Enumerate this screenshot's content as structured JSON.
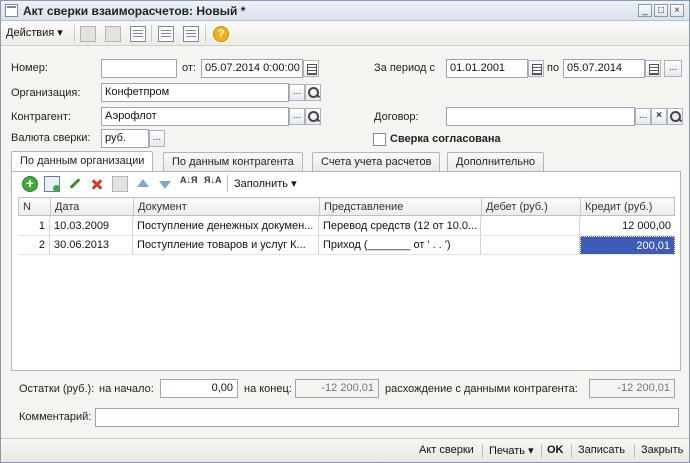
{
  "window": {
    "title": "Акт сверки взаиморасчетов: Новый *",
    "controls": {
      "minimize": "_",
      "maximize": "□",
      "close": "×"
    }
  },
  "toolbar": {
    "actions_label": "Действия",
    "icons": [
      "disabled-icon",
      "disabled-icon",
      "refresh-icon",
      "document-icon",
      "list-icon",
      "help-icon"
    ],
    "help_glyph": "?"
  },
  "header": {
    "number_label": "Номер:",
    "number_value": "",
    "from_label": "от:",
    "from_value": "05.07.2014  0:00:00",
    "period_label": "За период с",
    "period_start": "01.01.2001",
    "period_to_label": "по",
    "period_end": "05.07.2014",
    "org_label": "Организация:",
    "org_value": "Конфетпром",
    "contractor_label": "Контрагент:",
    "contractor_value": "Аэрофлот",
    "contract_label": "Договор:",
    "contract_value": "",
    "currency_label": "Валюта сверки:",
    "currency_value": "руб.",
    "agreed_label": "Сверка согласована",
    "ellipsis": "...",
    "clear_glyph": "×"
  },
  "tabs": [
    {
      "label": "По данным организации",
      "active": true
    },
    {
      "label": "По данным контрагента",
      "active": false
    },
    {
      "label": "Счета учета расчетов",
      "active": false
    },
    {
      "label": "Дополнительно",
      "active": false
    }
  ],
  "panel_toolbar": {
    "fill_label": "Заполнить",
    "sort_asc": "А↓Я",
    "sort_desc": "Я↓А"
  },
  "table": {
    "columns": [
      "N",
      "Дата",
      "Документ",
      "Представление",
      "Дебет (руб.)",
      "Кредит (руб.)"
    ],
    "rows": [
      {
        "n": "1",
        "date": "10.03.2009",
        "document": "Поступление денежных докумен...",
        "repr": "Перевод средств (12 от 10.0...",
        "debit": "",
        "credit": "12 000,00"
      },
      {
        "n": "2",
        "date": "30.06.2013",
        "document": "Поступление товаров и услуг К...",
        "repr": "Приход (_______ от ' .    .     ')",
        "debit": "",
        "credit": "200,01"
      }
    ]
  },
  "balances": {
    "label": "Остатки (руб.):",
    "start_label": "на начало:",
    "start_value": "0,00",
    "end_label": "на конец:",
    "end_value": "-12 200,01",
    "diff_label": "расхождение с данными контрагента:",
    "diff_value": "-12 200,01"
  },
  "comment": {
    "label": "Комментарий:",
    "value": ""
  },
  "footer": {
    "act_label": "Акт сверки",
    "print_label": "Печать",
    "ok_label": "OK",
    "save_label": "Записать",
    "close_label": "Закрыть"
  }
}
